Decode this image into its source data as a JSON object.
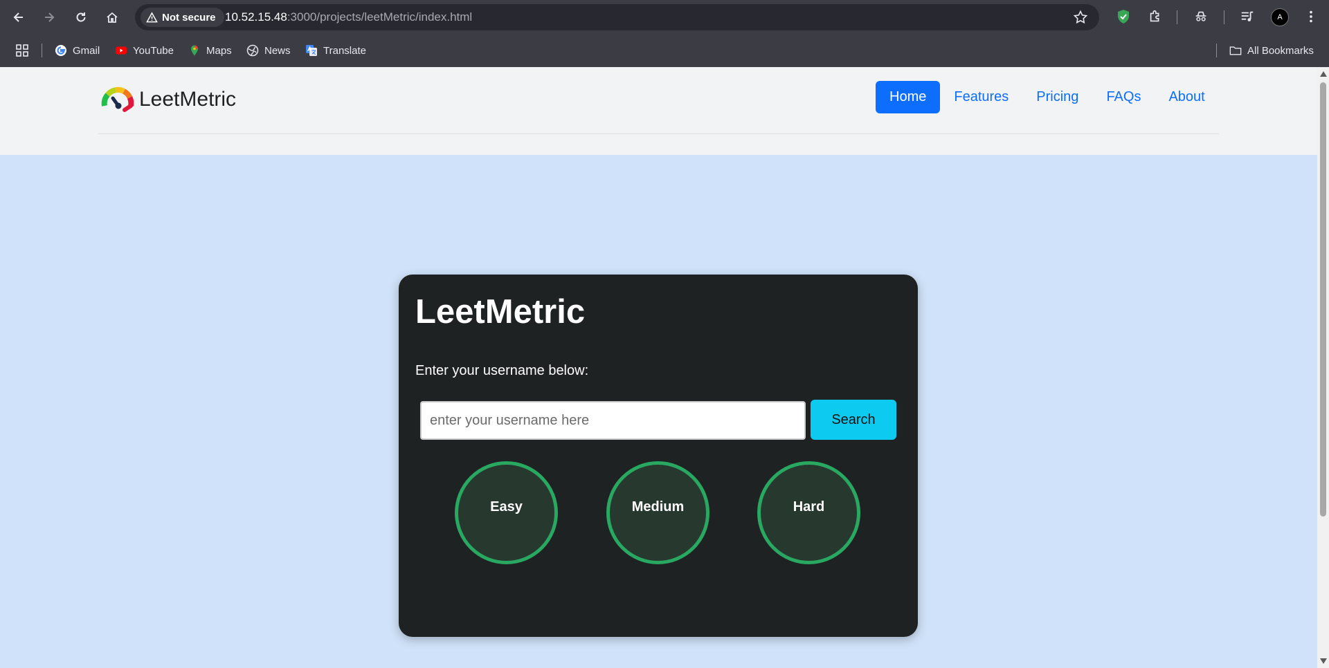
{
  "browser": {
    "security_label": "Not secure",
    "url_host": "10.52.15.48",
    "url_rest": ":3000/projects/leetMetric/index.html",
    "avatar_text": "A"
  },
  "bookmarks": {
    "items": [
      {
        "label": "Gmail",
        "icon": "google-icon"
      },
      {
        "label": "YouTube",
        "icon": "youtube-icon"
      },
      {
        "label": "Maps",
        "icon": "maps-icon"
      },
      {
        "label": "News",
        "icon": "globe-icon"
      },
      {
        "label": "Translate",
        "icon": "translate-icon"
      }
    ],
    "all_bookmarks": "All Bookmarks"
  },
  "header": {
    "brand": "LeetMetric",
    "nav": [
      {
        "label": "Home",
        "active": true
      },
      {
        "label": "Features"
      },
      {
        "label": "Pricing"
      },
      {
        "label": "FAQs"
      },
      {
        "label": "About"
      }
    ]
  },
  "card": {
    "title": "LeetMetric",
    "label": "Enter your username below:",
    "input_placeholder": "enter your username here",
    "search_label": "Search",
    "circles": [
      "Easy",
      "Medium",
      "Hard"
    ]
  },
  "colors": {
    "accent": "#0d6efd",
    "search_button": "#0dcaf0",
    "card_bg": "#1f2223",
    "circle_border": "#28a861",
    "page_bg": "#d0e2f9"
  }
}
